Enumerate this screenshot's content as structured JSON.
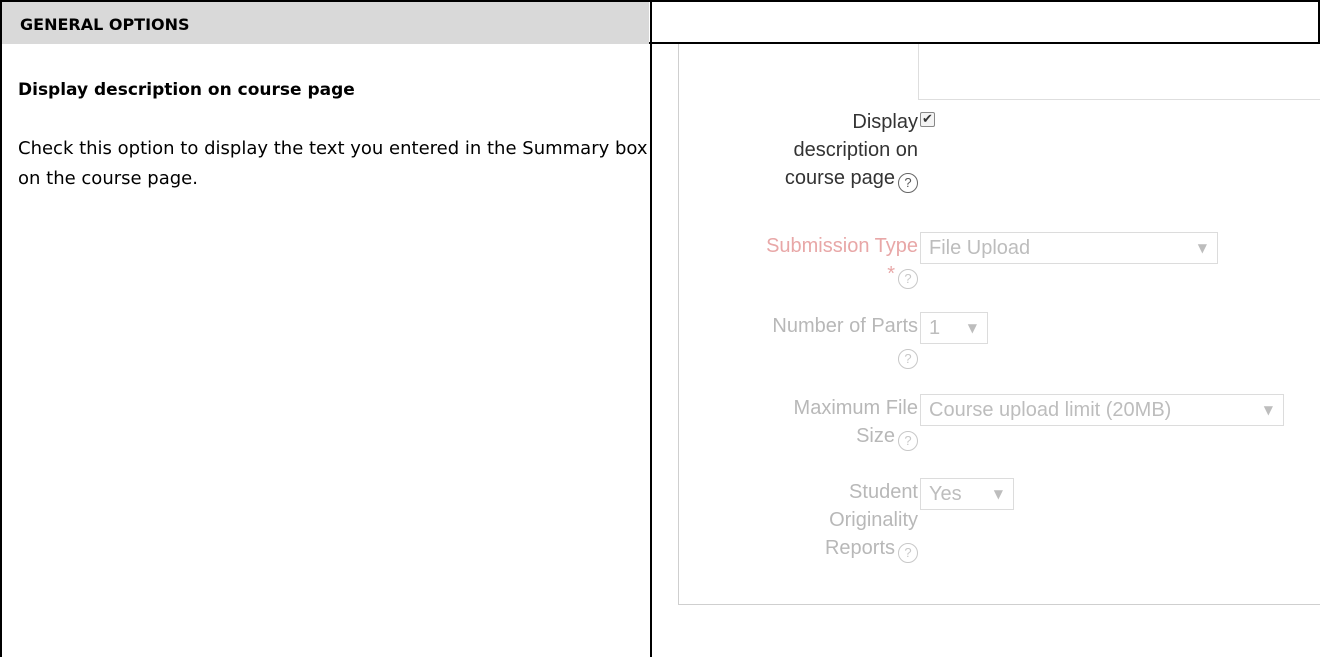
{
  "header": {
    "title": "GENERAL OPTIONS"
  },
  "left": {
    "heading": "Display description on course page",
    "description": "Check this option to display the text you entered in the Summary box on the course page."
  },
  "form": {
    "display_description": {
      "label_lines": [
        "Display",
        "description on",
        "course page"
      ],
      "checked": true,
      "check_glyph": "✔"
    },
    "submission_type": {
      "label_lines": [
        "Submission Type",
        "*"
      ],
      "value": "File Upload"
    },
    "number_of_parts": {
      "label_lines": [
        "Number of Parts"
      ],
      "value": "1"
    },
    "max_file_size": {
      "label_lines": [
        "Maximum File",
        "Size"
      ],
      "value": "Course upload limit (20MB)"
    },
    "originality_reports": {
      "label_lines": [
        "Student",
        "Originality",
        "Reports"
      ],
      "value": "Yes"
    },
    "help_glyph": "?",
    "caret_glyph": "▼"
  },
  "colors": {
    "header_bg": "#d9d9d9",
    "required_label": "#e8a7a7",
    "muted_label": "#b8b8b8"
  }
}
